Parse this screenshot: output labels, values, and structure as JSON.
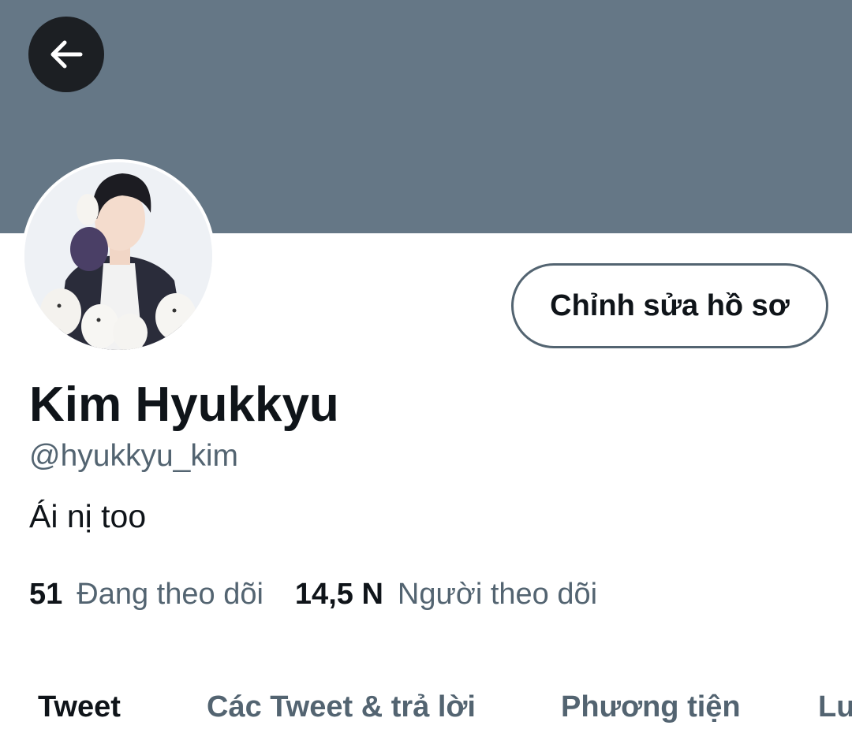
{
  "header": {
    "back_icon": "arrow-left-icon",
    "banner_color": "#657786"
  },
  "profile": {
    "avatar_alt": "profile photo",
    "edit_button_label": "Chỉnh sửa hồ sơ",
    "display_name": "Kim Hyukkyu",
    "handle": "@hyukkyu_kim",
    "bio": "Ái nị too"
  },
  "stats": {
    "following_count": "51",
    "following_label": "Đang theo dõi",
    "followers_count": "14,5 N",
    "followers_label": "Người theo dõi"
  },
  "tabs": [
    {
      "label": "Tweet",
      "active": true
    },
    {
      "label": "Các Tweet & trả lời",
      "active": false
    },
    {
      "label": "Phương tiện",
      "active": false
    },
    {
      "label": "Lượt thích",
      "active": false
    }
  ],
  "colors": {
    "primary_text": "#0f1419",
    "secondary_text": "#536471",
    "banner": "#657786"
  }
}
